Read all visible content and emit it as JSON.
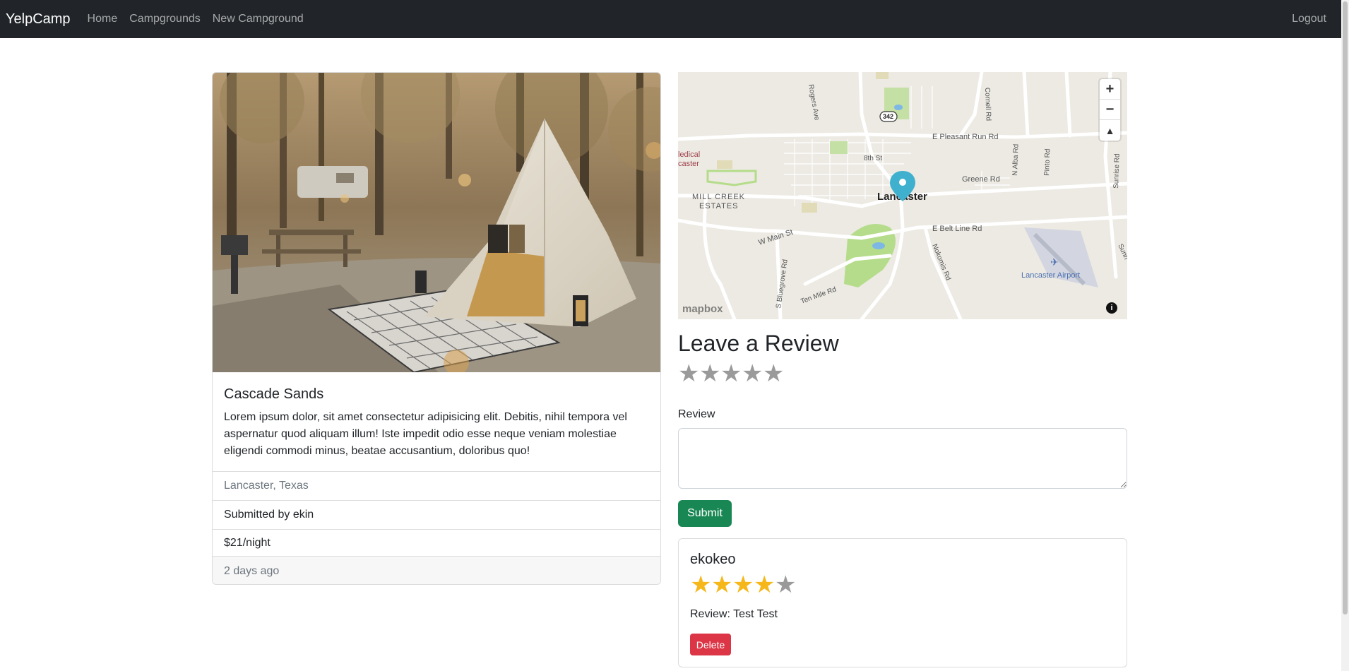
{
  "navbar": {
    "brand": "YelpCamp",
    "links": [
      "Home",
      "Campgrounds",
      "New Campground"
    ],
    "logout": "Logout"
  },
  "campground": {
    "title": "Cascade Sands",
    "description": "Lorem ipsum dolor, sit amet consectetur adipisicing elit. Debitis, nihil tempora vel aspernatur quod aliquam illum! Iste impedit odio esse neque veniam molestiae eligendi commodi minus, beatae accusantium, doloribus quo!",
    "location": "Lancaster, Texas",
    "submitted_by": "Submitted by ekin",
    "price": "$21/night",
    "posted": "2 days ago"
  },
  "map": {
    "city_label": "Lancaster",
    "road_labels": [
      "E Pleasant Run Rd",
      "Greene Rd",
      "E Belt Line Rd",
      "W Main St",
      "8th St",
      "Ten Mile Rd",
      "Nokomis Rd",
      "S Bluegrove Rd",
      "Rogers Ave",
      "Cornell Rd",
      "N Alba Rd",
      "Pinto Rd",
      "Sunrise Rd",
      "Sunri",
      "MILL CREEK",
      "ESTATES",
      "Lancaster Airport",
      "ledical",
      "caster"
    ],
    "highway_shield": "342",
    "attribution": "mapbox",
    "zoom_in": "+",
    "zoom_out": "−",
    "compass": "▲",
    "info": "i"
  },
  "review_form": {
    "heading": "Leave a Review",
    "rating_stars": [
      "★",
      "★",
      "★",
      "★",
      "★"
    ],
    "label": "Review",
    "submit": "Submit"
  },
  "reviews": [
    {
      "author": "ekokeo",
      "rating": 4,
      "max_rating": 5,
      "star_glyph": "★",
      "text": "Review: Test Test",
      "delete_label": "Delete"
    }
  ],
  "colors": {
    "navbar_bg": "#212529",
    "submit_green": "#198754",
    "delete_red": "#dc3545",
    "star_gold": "#f6b71a",
    "star_gray": "#9a9a9a",
    "map_marker": "#3fb1ce"
  }
}
